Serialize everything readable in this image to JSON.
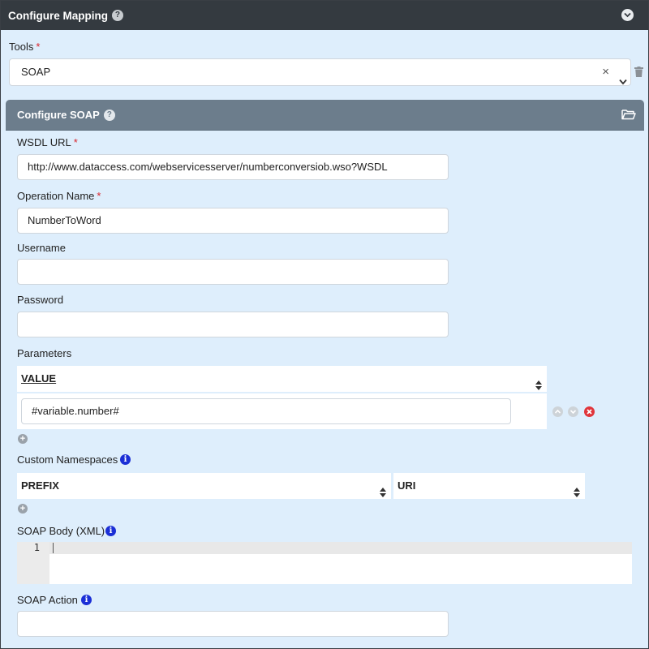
{
  "header": {
    "title": "Configure Mapping",
    "help_glyph": "?"
  },
  "tools": {
    "label": "Tools",
    "required_mark": "*",
    "selected": "SOAP",
    "clear_glyph": "×"
  },
  "soap": {
    "title": "Configure SOAP",
    "help_glyph": "?",
    "wsdl": {
      "label": "WSDL URL",
      "required_mark": "*",
      "value": "http://www.dataccess.com/webservicesserver/numberconversiob.wso?WSDL"
    },
    "operation": {
      "label": "Operation Name",
      "required_mark": "*",
      "value": "NumberToWord"
    },
    "username": {
      "label": "Username",
      "value": ""
    },
    "password": {
      "label": "Password",
      "value": ""
    },
    "parameters": {
      "label": "Parameters",
      "column": "VALUE",
      "rows": [
        {
          "value": "#variable.number#"
        }
      ]
    },
    "namespaces": {
      "label": "Custom Namespaces",
      "columns": [
        "PREFIX",
        "URI"
      ]
    },
    "body": {
      "label": "SOAP Body (XML)",
      "line_number": "1"
    },
    "action": {
      "label": "SOAP Action",
      "value": ""
    },
    "info_glyph": "i",
    "plus_glyph": "+"
  },
  "colors": {
    "topbar": "#343a40",
    "card_header": "#6c7d8c",
    "background": "#deeefc",
    "required": "#d9252d",
    "info": "#1b2fd6",
    "remove": "#e0353b"
  }
}
